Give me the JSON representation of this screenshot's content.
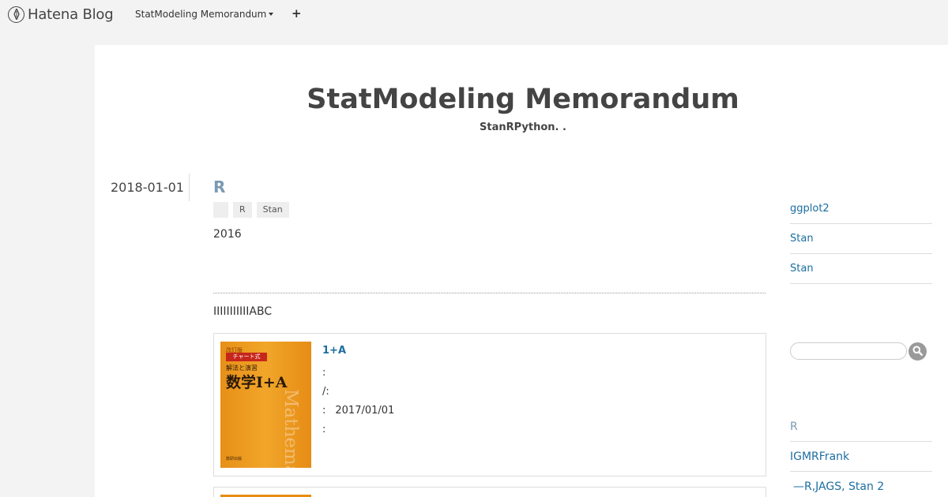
{
  "topbar": {
    "logo_text": "Hatena Blog",
    "blog_switch_label": "StatModeling Memorandum",
    "plus_label": "+"
  },
  "header": {
    "title": "StatModeling Memorandum",
    "description": "StanRPython. ."
  },
  "entry": {
    "date": "2018-01-01",
    "title": "R",
    "categories": [
      "",
      "R",
      "Stan"
    ],
    "year": "2016",
    "body_line": "IIIIIIIIIIIABC"
  },
  "book": {
    "cover": {
      "edition": "改訂版",
      "series": "チャート式",
      "subtitle": "解法と演習",
      "main": "数学I+A",
      "watermark": "Mathematics",
      "publisher": "数研出版"
    },
    "title": "1+A",
    "rows": [
      {
        "label": ":",
        "value": ""
      },
      {
        "label": "/:",
        "value": ""
      },
      {
        "label": ":",
        "value": "2017/01/01"
      },
      {
        "label": ":",
        "value": ""
      }
    ]
  },
  "sidebar": {
    "links": [
      "ggplot2",
      "Stan",
      "Stan"
    ],
    "search_placeholder": "",
    "recent": [
      {
        "label": "R",
        "color": "#7a9ab3"
      },
      {
        "label": "IGMRFrank",
        "color": "#1c6ea0"
      },
      {
        "label": "—R,JAGS, Stan 2",
        "color": "#1c6ea0"
      }
    ]
  },
  "colors": {
    "link": "#1c6ea0",
    "entry_title": "#7a9ab3",
    "page_bg": "#f3f3f3"
  }
}
